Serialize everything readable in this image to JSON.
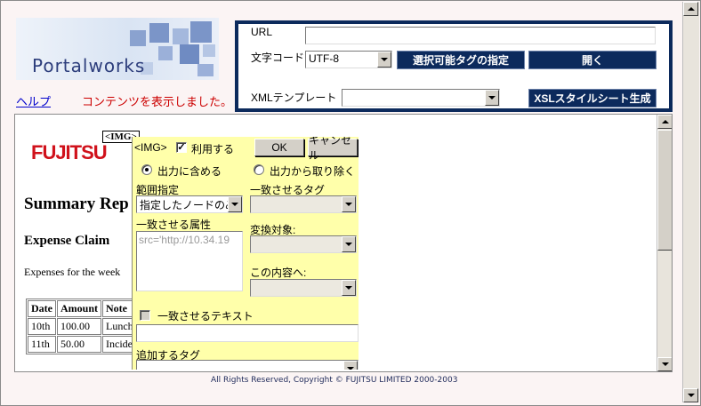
{
  "header": {
    "logo_text": "Portalworks",
    "help_link": "ヘルプ",
    "status_message": "コンテンツを表示しました。"
  },
  "control_panel": {
    "url_label": "URL",
    "url_value": "",
    "charset_label": "文字コード",
    "charset_value": "UTF-8",
    "select_tags_button": "選択可能タグの指定",
    "open_button": "開く",
    "xml_template_label": "XMLテンプレート",
    "xml_template_value": "",
    "generate_xsl_button": "XSLスタイルシート生成"
  },
  "document": {
    "logo": "FUJITSU",
    "report_title": "Summary Rep",
    "section_title": "Expense Claim",
    "body_text": "Expenses for the week",
    "img_marker": "<IMG>",
    "table": {
      "headers": [
        "Date",
        "Amount",
        "Note"
      ],
      "rows": [
        [
          "10th",
          "100.00",
          "Lunch"
        ],
        [
          "11th",
          "50.00",
          "Incider"
        ]
      ]
    }
  },
  "tag_editor": {
    "tag_name": "<IMG>",
    "use_label": "利用する",
    "use_checked": true,
    "ok_button": "OK",
    "cancel_button": "キャンセル",
    "include_output_label": "出力に含める",
    "exclude_output_label": "出力から取り除く",
    "range_label": "範囲指定",
    "range_value": "指定したノードのみ",
    "match_tag_label": "一致させるタグ",
    "match_tag_value": "",
    "match_attr_label": "一致させる属性",
    "match_attr_value": "src='http://10.34.19",
    "convert_target_label": "変換対象:",
    "convert_target_value": "",
    "to_content_label": "この内容へ:",
    "to_content_value": "",
    "match_text_label": "一致させるテキスト",
    "match_text_value": "",
    "add_tag_label": "追加するタグ",
    "add_tag_value": ""
  },
  "footer": {
    "copyright": "All Rights Reserved, Copyright © FUJITSU LIMITED 2000-2003"
  }
}
